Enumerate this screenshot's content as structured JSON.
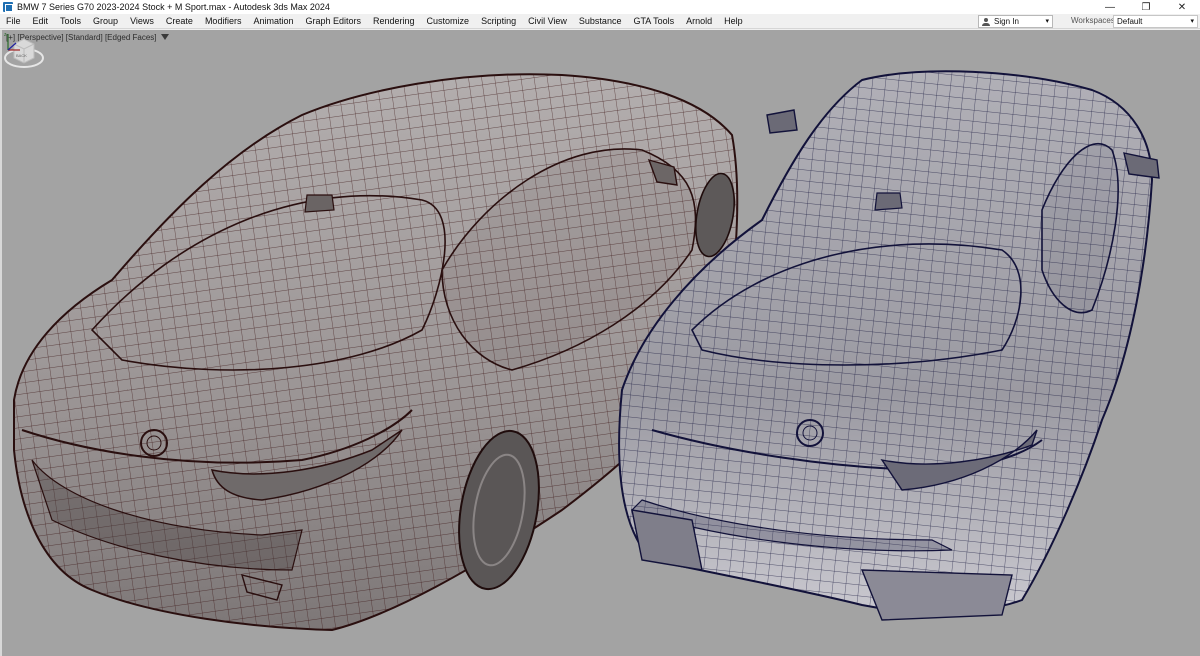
{
  "window": {
    "title": "BMW 7 Series G70 2023-2024 Stock + M Sport.max - Autodesk 3ds Max 2024",
    "controls": {
      "minimize": "—",
      "restore": "❐",
      "close": "✕"
    }
  },
  "menu": {
    "items": [
      "File",
      "Edit",
      "Tools",
      "Group",
      "Views",
      "Create",
      "Modifiers",
      "Animation",
      "Graph Editors",
      "Rendering",
      "Customize",
      "Scripting",
      "Civil View",
      "Substance",
      "GTA Tools",
      "Arnold",
      "Help"
    ]
  },
  "account": {
    "signin_label": "Sign In",
    "caret": "▾"
  },
  "workspaces": {
    "label": "Workspaces:",
    "value": "Default",
    "caret": "▾"
  },
  "viewport": {
    "label": "[+] [Perspective] [Standard] [Edged Faces]",
    "background": "#a3a3a3",
    "viewcube_face": "BACK"
  },
  "colors": {
    "wire_left": "#3a1414",
    "wire_right": "#14143a",
    "accent": "#1f6fb2"
  },
  "icons": [
    "app-icon",
    "user-icon",
    "filter-icon",
    "viewcube-icon",
    "axis-tripod-icon"
  ]
}
